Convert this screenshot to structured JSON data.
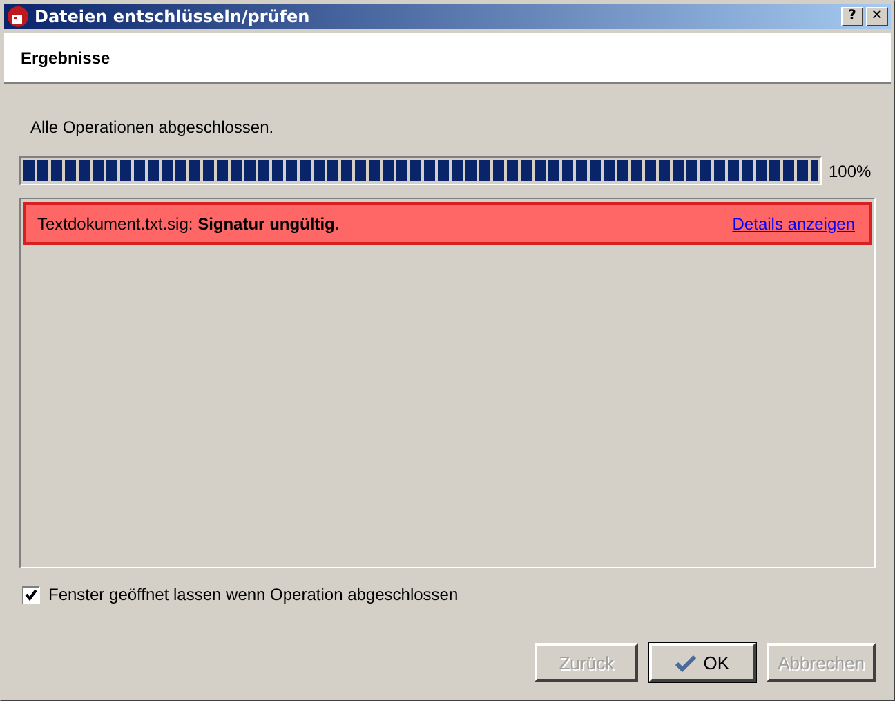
{
  "window": {
    "title": "Dateien entschlüsseln/prüfen"
  },
  "title_buttons": [
    "?",
    "✕"
  ],
  "header": {
    "title": "Ergebnisse"
  },
  "status": "Alle Operationen abgeschlossen.",
  "progress": {
    "level": 1,
    "reading": "100%"
  },
  "results": [
    {
      "kind": "error",
      "text": "Textdokument.txt.sig: **Signatur ungültig.**",
      "link": "Details anzeigen"
    }
  ],
  "keep_open": {
    "label": "Fenster geöffnet lassen wenn Operation abgeschlossen",
    "checked": true
  },
  "buttons": [
    {
      "label": "Zurück",
      "disabled": true,
      "icon": false
    },
    {
      "label": "OK",
      "disabled": false,
      "icon": true
    },
    {
      "label": "Abbrechen",
      "disabled": true,
      "icon": false
    }
  ]
}
